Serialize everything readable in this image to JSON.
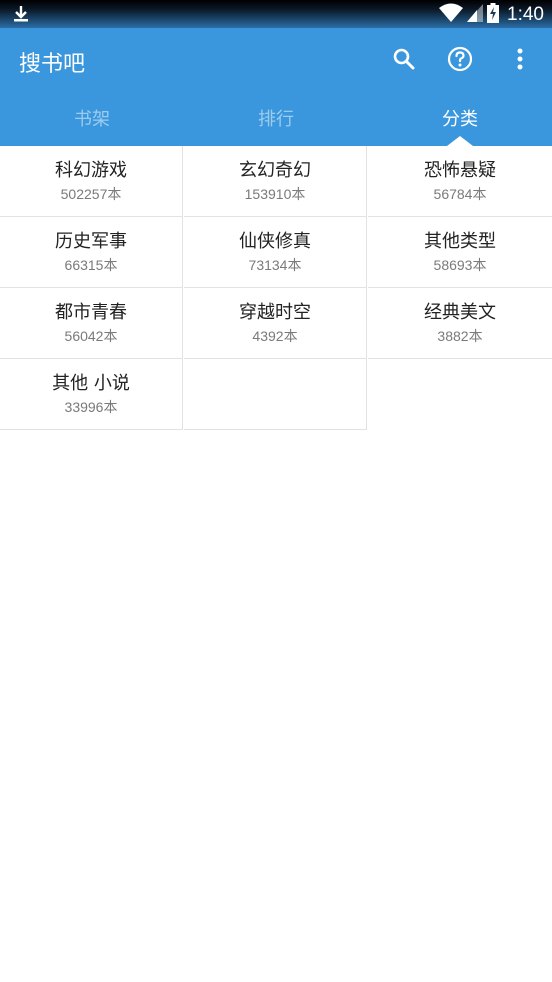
{
  "status_bar": {
    "time": "1:40",
    "icons": [
      "download-icon",
      "wifi-icon",
      "signal-icon",
      "battery-charging-icon"
    ]
  },
  "app_bar": {
    "title": "搜书吧",
    "actions": [
      "search-icon",
      "help-icon",
      "more-vert-icon"
    ],
    "color": "#3a97dd"
  },
  "tabs": [
    {
      "label": "书架",
      "active": false
    },
    {
      "label": "排行",
      "active": false
    },
    {
      "label": "分类",
      "active": true
    }
  ],
  "categories": [
    {
      "name": "科幻游戏",
      "count": "502257本"
    },
    {
      "name": "玄幻奇幻",
      "count": "153910本"
    },
    {
      "name": "恐怖悬疑",
      "count": "56784本"
    },
    {
      "name": "历史军事",
      "count": "66315本"
    },
    {
      "name": "仙侠修真",
      "count": "73134本"
    },
    {
      "name": "其他类型",
      "count": "58693本"
    },
    {
      "name": "都市青春",
      "count": "56042本"
    },
    {
      "name": "穿越时空",
      "count": "4392本"
    },
    {
      "name": "经典美文",
      "count": "3882本"
    },
    {
      "name": "其他 小说",
      "count": "33996本"
    }
  ]
}
